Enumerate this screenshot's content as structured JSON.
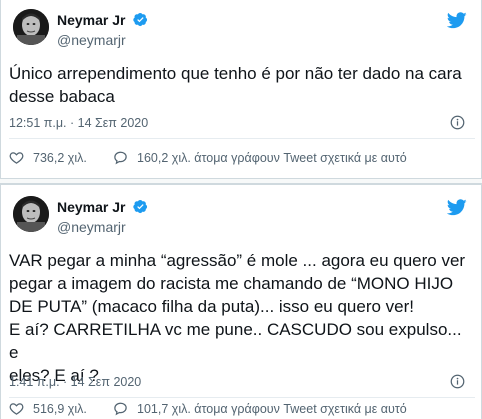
{
  "colors": {
    "text": "#0f1419",
    "muted": "#536471",
    "twitter_blue": "#1d9bf0",
    "border": "#cfd9de"
  },
  "icons": {
    "avatar": "profile-photo",
    "verified": "verified-badge-icon",
    "logo": "twitter-bird-icon",
    "info": "info-icon",
    "like": "heart-icon",
    "reply": "speech-bubble-icon"
  },
  "tweets": [
    {
      "display_name": "Neymar Jr",
      "handle": "@neymarjr",
      "text_lines": [
        "Único arrependimento que tenho é por não ter dado na cara",
        "desse babaca"
      ],
      "timestamp": "12:51 π.μ. · 14 Σεπ 2020",
      "likes": "736,2 χιλ.",
      "replies_text": "160,2 χιλ. άτομα γράφουν Tweet σχετικά με αυτό"
    },
    {
      "display_name": "Neymar Jr",
      "handle": "@neymarjr",
      "text_lines": [
        "VAR pegar a minha “agressão” é mole ... agora eu quero ver",
        "pegar a imagem do racista me chamando de “MONO HIJO",
        "DE PUTA” (macaco filha da puta)... isso eu quero ver!",
        "E aí? CARRETILHA vc me pune.. CASCUDO sou expulso... e",
        "eles? E aí ?"
      ],
      "timestamp": "1:41 π.μ. · 14 Σεπ 2020",
      "likes": "516,9 χιλ.",
      "replies_text": "101,7 χιλ. άτομα γράφουν Tweet σχετικά με αυτό"
    }
  ]
}
